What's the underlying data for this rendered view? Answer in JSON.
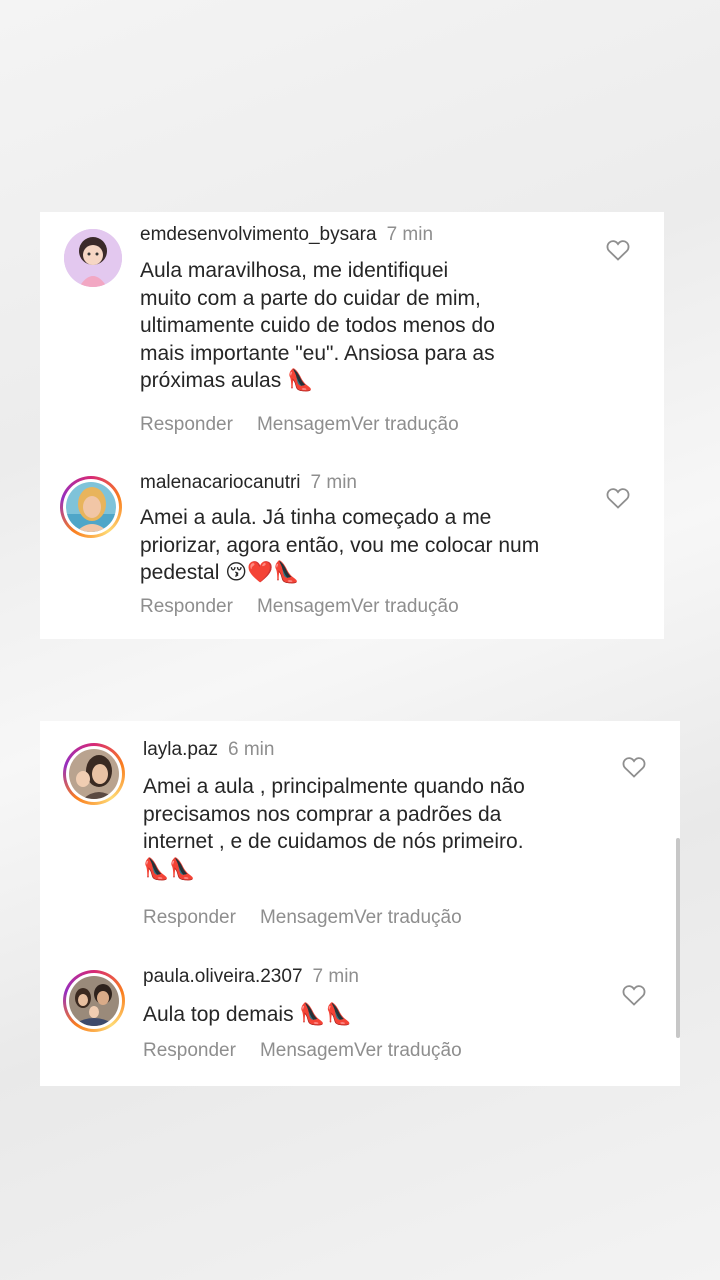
{
  "comments_top": [
    {
      "username": "emdesenvolvimento_bysara",
      "time": "7 min",
      "text": "Aula maravilhosa, me identifiquei\nmuito com a parte do cuidar de mim,\nultimamente cuido de todos menos do\nmais importante \"eu\". Ansiosa para as\npróximas aulas 👠",
      "reply": "Responder",
      "message": "Mensagem",
      "translate": "Ver tradução"
    },
    {
      "username": "malenacariocanutri",
      "time": "7 min",
      "text": "Amei a aula. Já tinha começado a me\npriorizar, agora então, vou me colocar num\npedestal 😚❤️👠",
      "reply": "Responder",
      "message": "Mensagem",
      "translate": "Ver tradução"
    }
  ],
  "comments_bottom": [
    {
      "username": "layla.paz",
      "time": "6 min",
      "text": "Amei a aula , principalmente quando não\nprecisamos nos comprar a padrões da\ninternet , e de cuidamos de nós primeiro.\n👠👠",
      "reply": "Responder",
      "message": "Mensagem",
      "translate": "Ver tradução"
    },
    {
      "username": "paula.oliveira.2307",
      "time": "7 min",
      "text": "Aula top demais 👠👠",
      "reply": "Responder",
      "message": "Mensagem",
      "translate": "Ver tradução"
    }
  ],
  "colors": {
    "text": "#262626",
    "secondary": "#8e8e8e",
    "card": "#ffffff"
  },
  "icons": [
    "heart-outline-icon",
    "high-heel-emoji"
  ]
}
